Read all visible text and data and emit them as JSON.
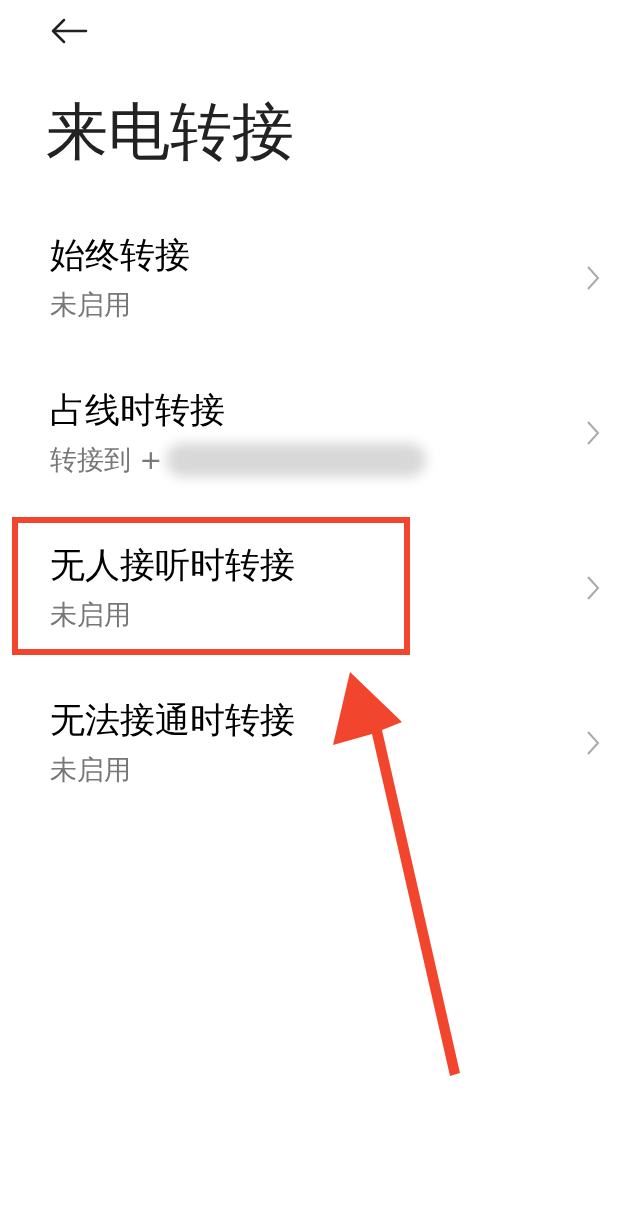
{
  "header": {
    "title": "来电转接"
  },
  "items": [
    {
      "title": "始终转接",
      "subtitle": "未启用",
      "redacted": false,
      "highlighted": false
    },
    {
      "title": "占线时转接",
      "subtitle": "转接到 +",
      "redacted": true,
      "highlighted": false
    },
    {
      "title": "无人接听时转接",
      "subtitle": "未启用",
      "redacted": false,
      "highlighted": true
    },
    {
      "title": "无法接通时转接",
      "subtitle": "未启用",
      "redacted": false,
      "highlighted": false
    }
  ],
  "annotation": {
    "kind": "arrow"
  }
}
